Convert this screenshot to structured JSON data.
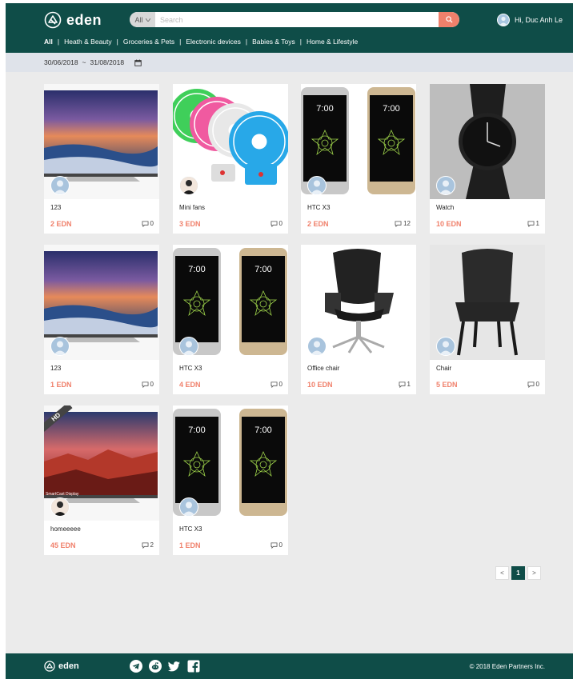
{
  "brand": {
    "name": "eden"
  },
  "search": {
    "category": "All",
    "placeholder": "Search"
  },
  "user": {
    "greeting": "Hi, Duc Anh Le"
  },
  "nav": [
    "All",
    "Heath & Beauty",
    "Groceries & Pets",
    "Electronic devices",
    "Babies & Toys",
    "Home & Lifestyle"
  ],
  "date_range": {
    "from": "30/06/2018",
    "separator": "~",
    "to": "31/08/2018"
  },
  "products": [
    {
      "title": "123",
      "price": "2 EDN",
      "comments": "0",
      "image": "tv"
    },
    {
      "title": "Mini fans",
      "price": "3 EDN",
      "comments": "0",
      "image": "fans"
    },
    {
      "title": "HTC X3",
      "price": "2 EDN",
      "comments": "12",
      "image": "phones"
    },
    {
      "title": "Watch",
      "price": "10 EDN",
      "comments": "1",
      "image": "watch"
    },
    {
      "title": "123",
      "price": "1 EDN",
      "comments": "0",
      "image": "tv"
    },
    {
      "title": "HTC X3",
      "price": "4 EDN",
      "comments": "0",
      "image": "phones"
    },
    {
      "title": "Office chair",
      "price": "10 EDN",
      "comments": "1",
      "image": "office-chair"
    },
    {
      "title": "Chair",
      "price": "5 EDN",
      "comments": "0",
      "image": "chair"
    },
    {
      "title": "homeeeee",
      "price": "45 EDN",
      "comments": "2",
      "image": "tv-hd"
    },
    {
      "title": "HTC X3",
      "price": "1 EDN",
      "comments": "0",
      "image": "phones"
    }
  ],
  "phone_time": "7:00",
  "hd_badge": "HD",
  "tv_caption": "SmartCast Display",
  "pagination": {
    "prev": "<",
    "current": "1",
    "next": ">"
  },
  "footer": {
    "copyright": "© 2018 Eden Partners Inc."
  },
  "colors": {
    "primary": "#0f4d48",
    "accent": "#f0806b",
    "background": "#ebebeb"
  },
  "icons": [
    "eden-logo-icon",
    "chevron-down-icon",
    "search-icon",
    "calendar-icon",
    "comment-icon",
    "telegram-icon",
    "reddit-icon",
    "twitter-icon",
    "facebook-icon"
  ]
}
